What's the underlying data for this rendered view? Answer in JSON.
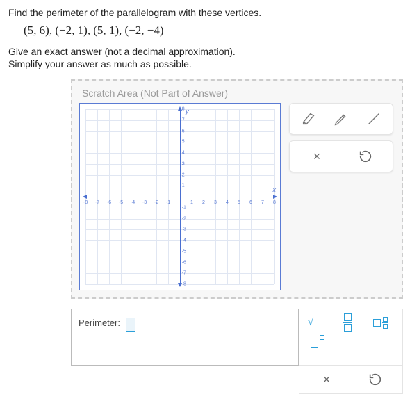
{
  "prompt": {
    "line1": "Find the perimeter of the parallelogram with these vertices.",
    "vertices": "(5, 6), (−2, 1), (5, 1), (−2, −4)",
    "instr1": "Give an exact answer (not a decimal approximation).",
    "instr2": "Simplify your answer as much as possible."
  },
  "scratch": {
    "title": "Scratch Area (Not Part of Answer)",
    "xlabel": "x",
    "ylabel": "y",
    "range": {
      "xmin": -8,
      "xmax": 8,
      "ymin": -8,
      "ymax": 8
    }
  },
  "tools": {
    "eraser": "eraser",
    "pencil": "pencil",
    "line": "line",
    "clear": "×",
    "reset": "↺"
  },
  "answer": {
    "label": "Perimeter:",
    "value": ""
  },
  "palette": {
    "sqrt": "√",
    "frac": "fraction",
    "mixedfrac": "mixed-fraction",
    "power": "power"
  }
}
